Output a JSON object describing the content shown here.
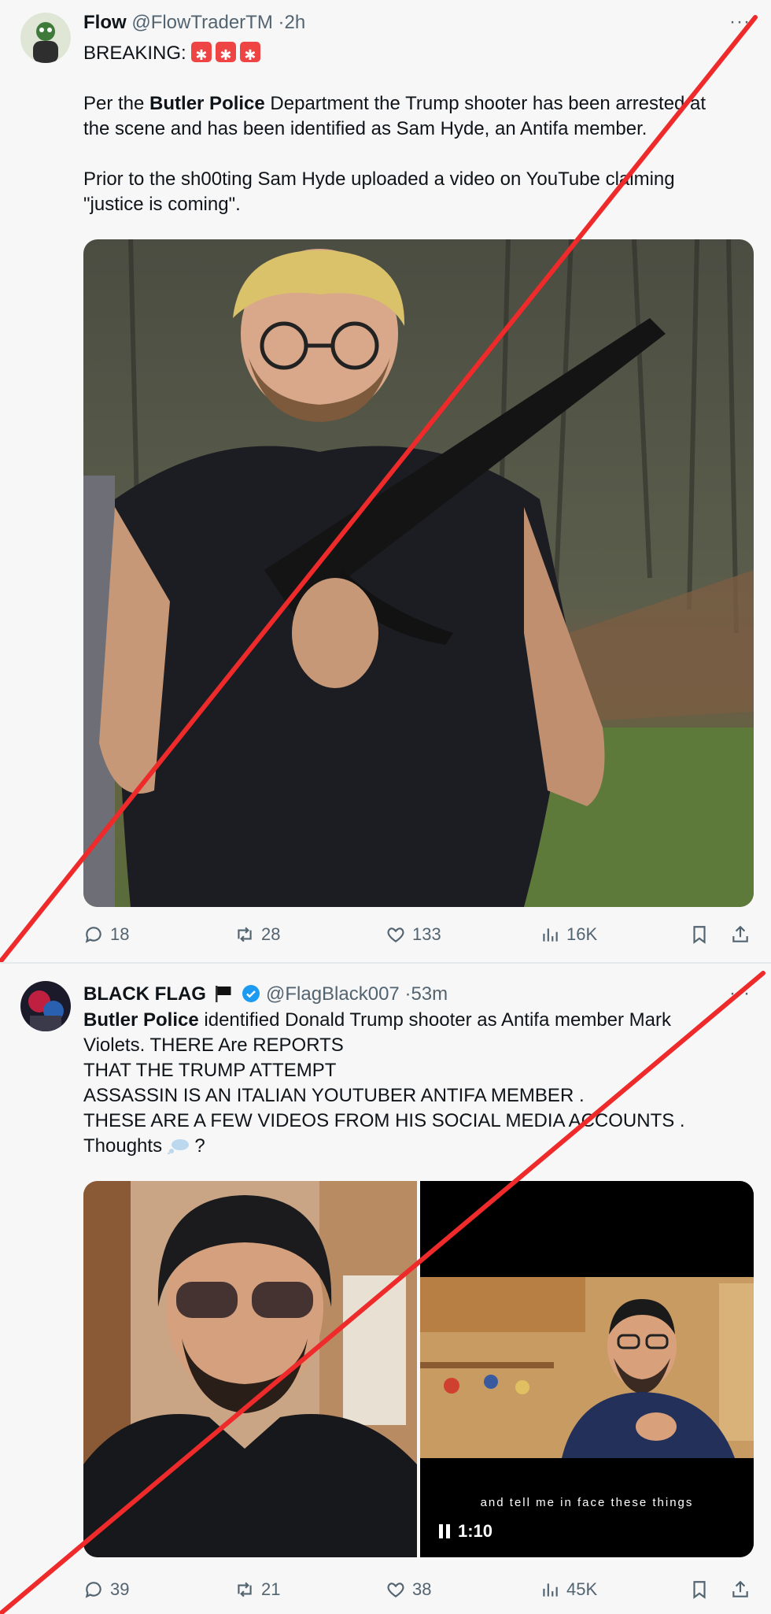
{
  "tweets": [
    {
      "name": "Flow",
      "handle": "@FlowTraderTM",
      "time": "2h",
      "more": "···",
      "lines": [
        {
          "before": "BREAKING: ",
          "bold": "",
          "after": ""
        },
        {
          "before": "Per the ",
          "bold": "Butler Police",
          "after": " Department the Trump shooter has been arrested at"
        },
        {
          "before": "the scene and has been identified as Sam Hyde, an Antifa member.",
          "bold": "",
          "after": ""
        },
        {
          "before": "Prior to the sh00ting Sam Hyde uploaded a video on YouTube claiming",
          "bold": "",
          "after": ""
        },
        {
          "before": "\"justice is coming\".",
          "bold": "",
          "after": ""
        }
      ],
      "stats": {
        "replies": "18",
        "reposts": "28",
        "likes": "133",
        "views": "16K"
      },
      "icons": [
        "reply-icon",
        "repost-icon",
        "like-icon",
        "views-icon",
        "bookmark-icon",
        "share-icon"
      ]
    },
    {
      "name": "BLACK FLAG",
      "handle": "@FlagBlack007",
      "time": "53m",
      "more": "···",
      "lines": [
        {
          "before": "",
          "bold": "Butler Police",
          "after": " identified Donald Trump shooter as Antifa member Mark"
        },
        {
          "before": "Violets. THERE Are REPORTS",
          "bold": "",
          "after": ""
        },
        {
          "before": "THAT THE TRUMP ATTEMPT",
          "bold": "",
          "after": ""
        },
        {
          "before": "ASSASSIN IS AN  ITALIAN YOUTUBER ANTIFA MEMBER .",
          "bold": "",
          "after": ""
        },
        {
          "before": "THESE ARE A FEW VIDEOS FROM HIS SOCIAL MEDIA ACCOUNTS .",
          "bold": "",
          "after": ""
        },
        {
          "before": "Thoughts ",
          "bold": "",
          "after": " ?"
        }
      ],
      "video": {
        "caption": "and tell me in face these things",
        "duration": "1:10"
      },
      "stats": {
        "replies": "39",
        "reposts": "21",
        "likes": "38",
        "views": "45K"
      },
      "icons": [
        "reply-icon",
        "repost-icon",
        "like-icon",
        "views-icon",
        "bookmark-icon",
        "share-icon"
      ]
    }
  ],
  "colors": {
    "accent_red": "#ee2a2a",
    "verified_blue": "#1d9bf0",
    "muted_text": "#536471"
  }
}
